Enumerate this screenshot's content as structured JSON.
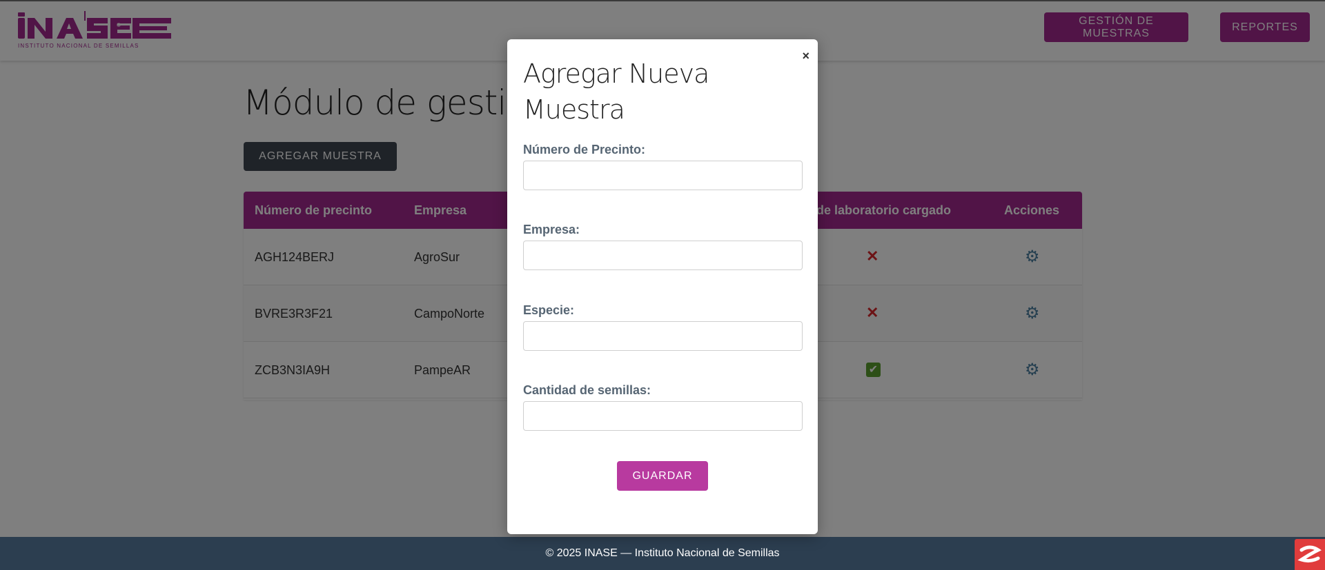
{
  "header": {
    "logo_text": "INASE",
    "logo_subtext": "INSTITUTO NACIONAL DE SEMILLAS",
    "nav": [
      {
        "label": "GESTIÓN DE MUESTRAS"
      },
      {
        "label": "REPORTES"
      }
    ],
    "brand_color": "#a3288f"
  },
  "main": {
    "title": "Módulo de gestión",
    "add_button": "AGREGAR MUESTRA",
    "table": {
      "columns": [
        "Número de precinto",
        "Empresa",
        "de laboratorio cargado",
        "Acciones"
      ],
      "rows": [
        {
          "precinto": "AGH124BERJ",
          "empresa": "AgroSur",
          "lab": "✕",
          "lab_status": "no",
          "action_icon": "gear-icon"
        },
        {
          "precinto": "BVRE3R3F21",
          "empresa": "CampoNorte",
          "lab": "✕",
          "lab_status": "no",
          "action_icon": "gear-icon"
        },
        {
          "precinto": "ZCB3N3IA9H",
          "empresa": "PampeAR",
          "lab": "✔",
          "lab_status": "yes",
          "action_icon": "gear-icon"
        }
      ]
    }
  },
  "modal": {
    "close": "×",
    "title": "Agregar Nueva Muestra",
    "fields": [
      {
        "label": "Número de Precinto:",
        "value": "",
        "placeholder": ""
      },
      {
        "label": "Empresa:",
        "value": "",
        "placeholder": ""
      },
      {
        "label": "Especie:",
        "value": "",
        "placeholder": ""
      },
      {
        "label": "Cantidad de semillas:",
        "value": "",
        "placeholder": ""
      }
    ],
    "save_button": "GUARDAR"
  },
  "footer": {
    "text": "© 2025 INASE — Instituto Nacional de Semillas"
  }
}
